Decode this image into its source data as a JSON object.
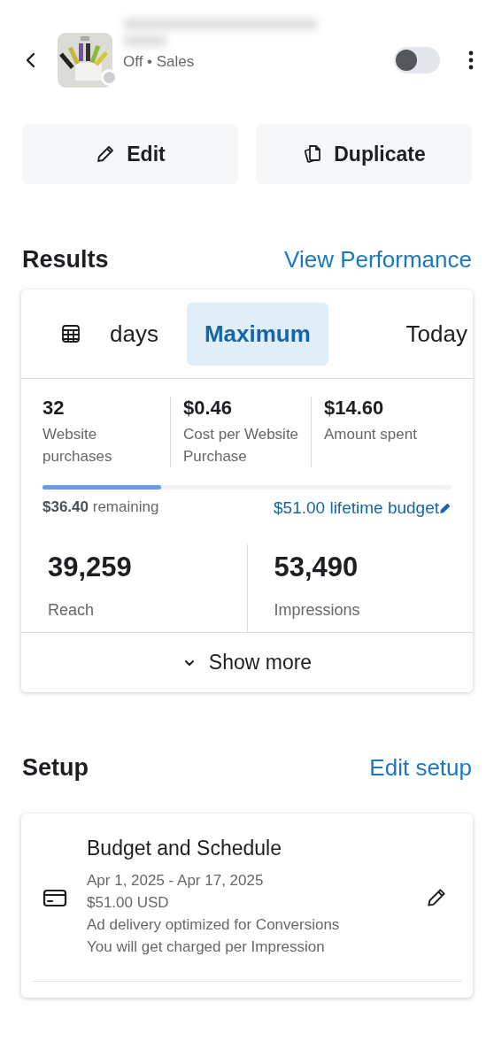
{
  "header": {
    "status": "Off",
    "separator": "•",
    "objective": "Sales",
    "toggle": {
      "on": false
    }
  },
  "actions": [
    {
      "kind": "edit",
      "label": "Edit"
    },
    {
      "kind": "duplicate",
      "label": "Duplicate"
    }
  ],
  "results": {
    "title": "Results",
    "link": "View Performance",
    "ranges": [
      {
        "label": "days",
        "selected": false
      },
      {
        "label": "Maximum",
        "selected": true
      },
      {
        "label": "Today",
        "selected": false
      }
    ],
    "metrics": [
      {
        "value": "32",
        "label": "Website purchases"
      },
      {
        "value": "$0.46",
        "label": "Cost per Website Purchase"
      },
      {
        "value": "$14.60",
        "label": "Amount spent"
      }
    ],
    "budget": {
      "level": 0.29,
      "remaining_amount": "$36.40",
      "remaining_label": "remaining",
      "lifetime": "$51.00 lifetime budget"
    },
    "totals": [
      {
        "value": "39,259",
        "label": "Reach"
      },
      {
        "value": "53,490",
        "label": "Impressions"
      }
    ],
    "show_more": "Show more"
  },
  "setup": {
    "title": "Setup",
    "link": "Edit setup",
    "items": [
      {
        "title": "Budget and Schedule",
        "lines": [
          "Apr 1, 2025 - Apr 17, 2025",
          "$51.00 USD",
          "Ad delivery optimized for Conversions",
          "You will get charged per Impression"
        ]
      }
    ]
  }
}
